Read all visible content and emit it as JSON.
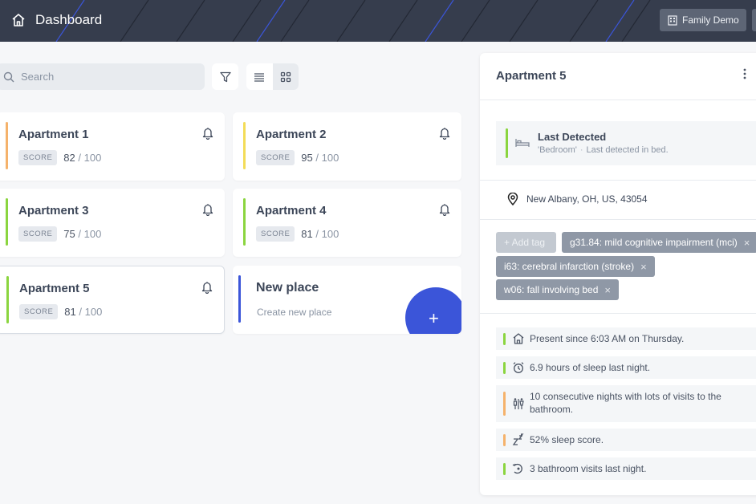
{
  "header": {
    "title": "Dashboard",
    "home_icon": "home-icon",
    "family_button_label": "Family Demo",
    "background": "#363d4d",
    "stripe_color": "#3b55d9"
  },
  "toolbar": {
    "search_placeholder": "Search",
    "filter_icon": "filter-icon",
    "list_view_icon": "list-view-icon",
    "grid_view_icon": "grid-view-icon",
    "active_view": "grid"
  },
  "places": [
    {
      "name": "Apartment 1",
      "score_label": "SCORE",
      "score": "82",
      "score_sep": "/",
      "score_max": "100",
      "status_color": "#f5b26b"
    },
    {
      "name": "Apartment 2",
      "score_label": "SCORE",
      "score": "95",
      "score_sep": "/",
      "score_max": "100",
      "status_color": "#f3dc58"
    },
    {
      "name": "Apartment 3",
      "score_label": "SCORE",
      "score": "75",
      "score_sep": "/",
      "score_max": "100",
      "status_color": "#8bd53f"
    },
    {
      "name": "Apartment 4",
      "score_label": "SCORE",
      "score": "81",
      "score_sep": "/",
      "score_max": "100",
      "status_color": "#8bd53f"
    },
    {
      "name": "Apartment 5",
      "score_label": "SCORE",
      "score": "81",
      "score_sep": "/",
      "score_max": "100",
      "status_color": "#8bd53f",
      "selected": true
    }
  ],
  "new_place": {
    "title": "New place",
    "subtitle": "Create new place",
    "fab_label": "+",
    "accent": "#3b55d9"
  },
  "panel": {
    "title": "Apartment 5",
    "last_detected": {
      "title": "Last Detected",
      "room": "'Bedroom'",
      "dot": "·",
      "detail": "Last detected in bed."
    },
    "address": "New Albany, OH, US, 43054",
    "add_tag_label": "+ Add tag",
    "tags": [
      "g31.84: mild cognitive impairment (mci)",
      "i63: cerebral infarction (stroke)",
      "w06: fall involving bed"
    ],
    "tag_remove": "×",
    "insights": [
      {
        "text": "Present since 6:03 AM on Thursday.",
        "icon": "home-icon",
        "color": "#8bd53f"
      },
      {
        "text": "6.9 hours of sleep last night.",
        "icon": "alarm-clock-icon",
        "color": "#8bd53f"
      },
      {
        "text": "10 consecutive nights with lots of visits to the bathroom.",
        "icon": "bathroom-icon",
        "color": "#f5b26b"
      },
      {
        "text": "52% sleep score.",
        "icon": "sleep-zzz-icon",
        "color": "#f5b26b"
      },
      {
        "text": "3 bathroom visits last night.",
        "icon": "bathroom-visit-icon",
        "color": "#8bd53f"
      }
    ]
  }
}
